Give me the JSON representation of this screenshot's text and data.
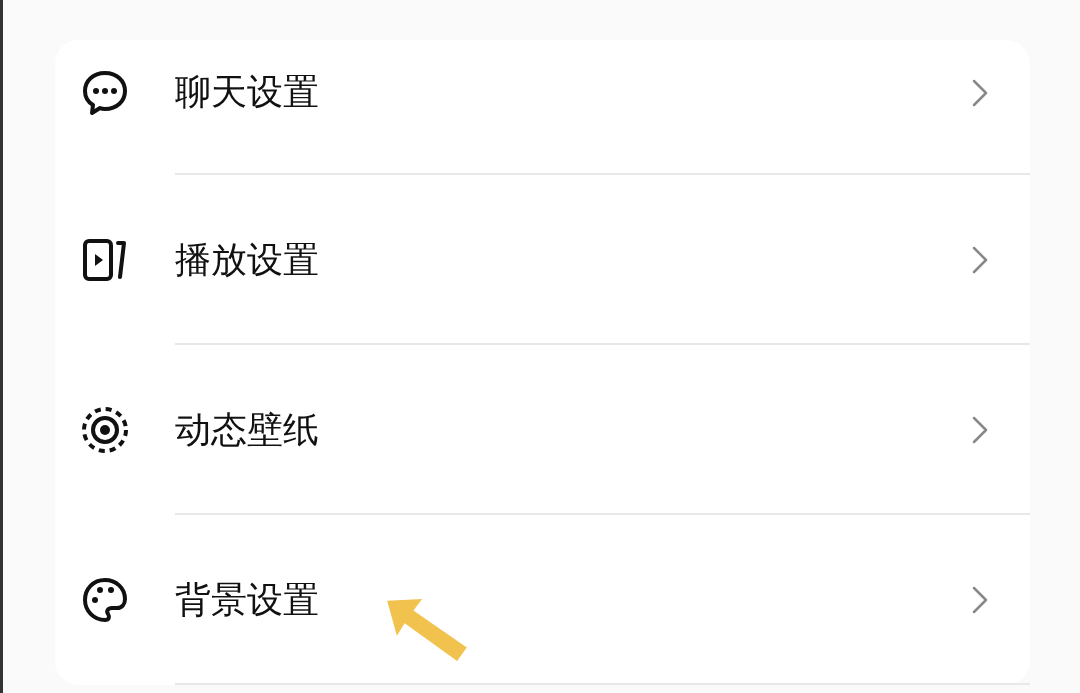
{
  "settings_items": [
    {
      "label": "聊天设置"
    },
    {
      "label": "播放设置"
    },
    {
      "label": "动态壁纸"
    },
    {
      "label": "背景设置"
    }
  ]
}
